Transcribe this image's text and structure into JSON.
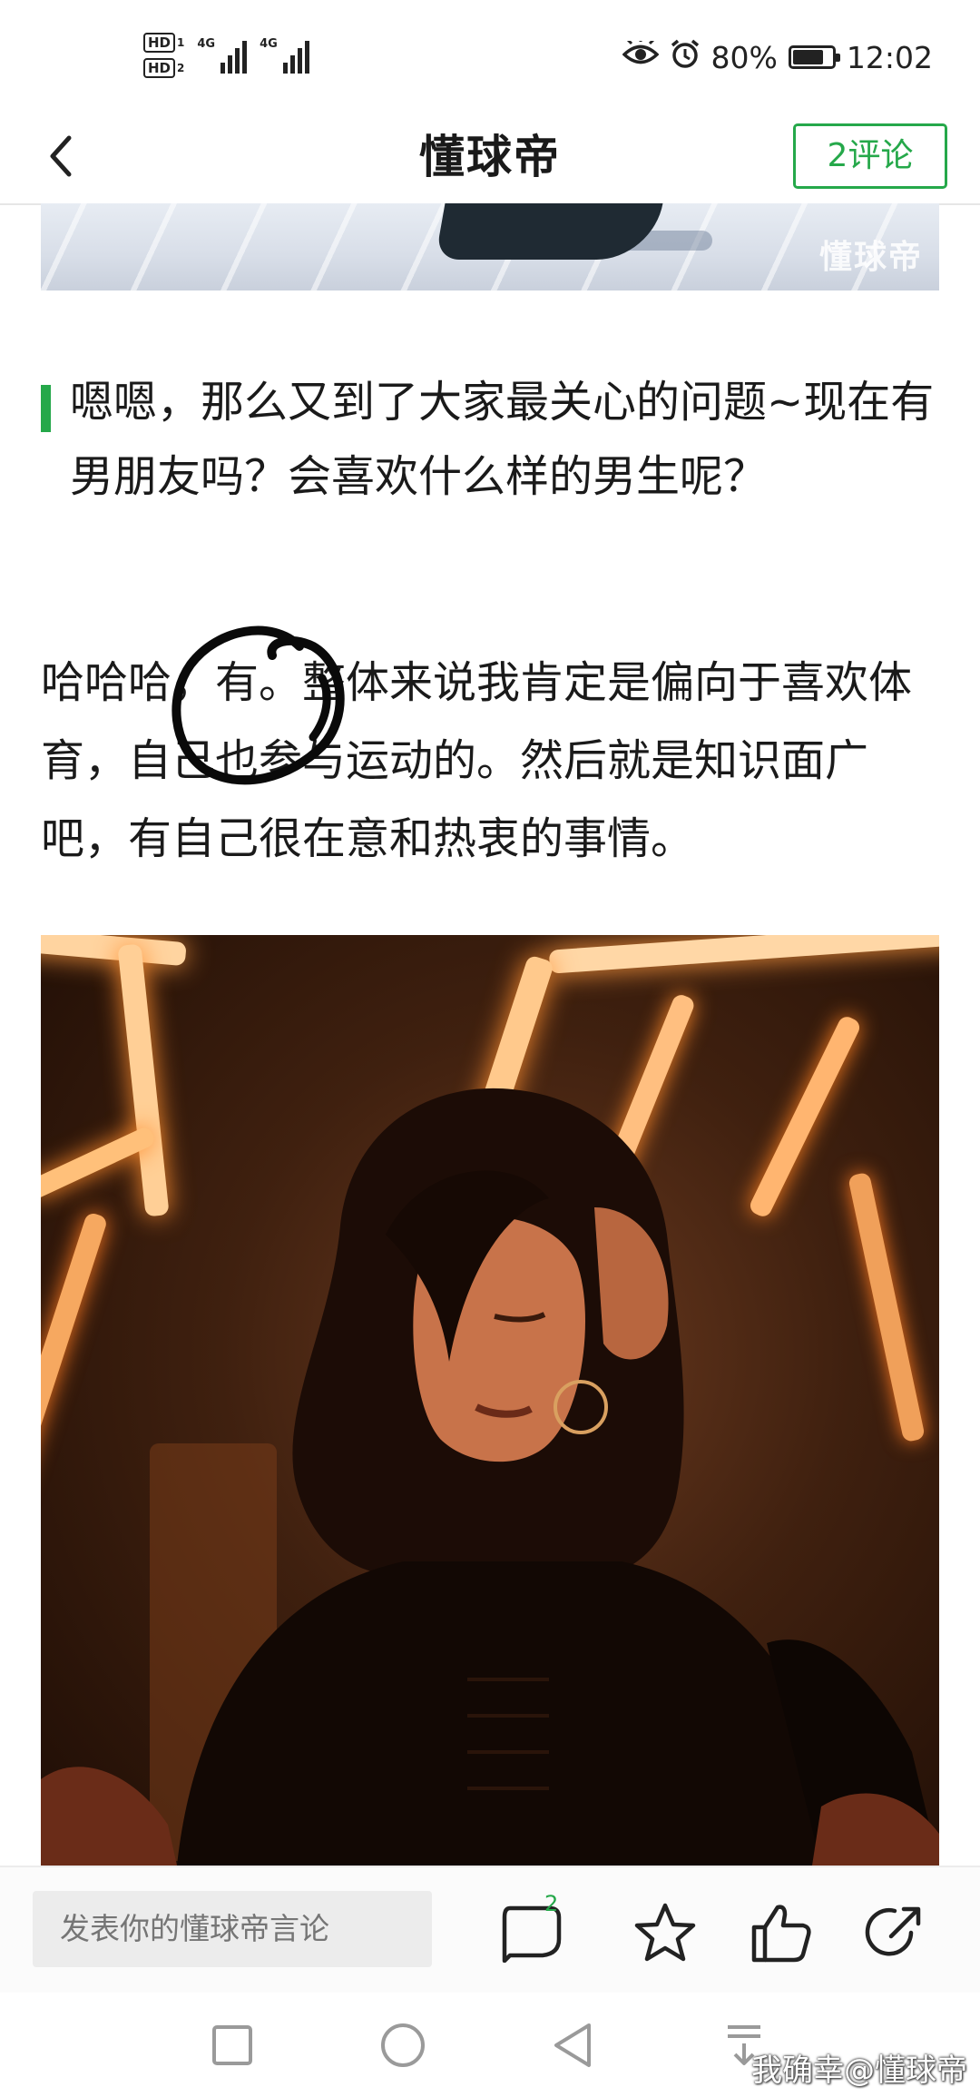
{
  "status_bar": {
    "hd1": "HD",
    "hd1_sub": "1",
    "hd2": "HD",
    "hd2_sub": "2",
    "network1": "4G",
    "network2": "4G",
    "battery_percent": "80%",
    "battery_level": 0.8,
    "time": "12:02",
    "icons": [
      "eye-icon",
      "alarm-icon",
      "battery-icon"
    ]
  },
  "nav": {
    "title": "懂球帝",
    "comment_button": "2评论",
    "back_icon": "chevron-left-icon"
  },
  "top_image": {
    "watermark": "懂球帝"
  },
  "article": {
    "question": "嗯嗯，那么又到了大家最关心的问题~现在有男朋友吗？会喜欢什么样的男生呢？",
    "answer": "哈哈哈，有。整体来说我肯定是偏向于喜欢体育，自己也参与运动的。然后就是知识面广吧，有自己很在意和热衷的事情。"
  },
  "bottom_bar": {
    "input_placeholder": "发表你的懂球帝言论",
    "comment_count": "2",
    "icons": [
      "comment-icon",
      "star-icon",
      "thumbs-up-icon",
      "share-icon"
    ]
  },
  "credit": "我确幸@懂球帝",
  "colors": {
    "accent_green": "#25a84a",
    "text": "#1a1a1a",
    "placeholder": "#9a9a9a"
  }
}
